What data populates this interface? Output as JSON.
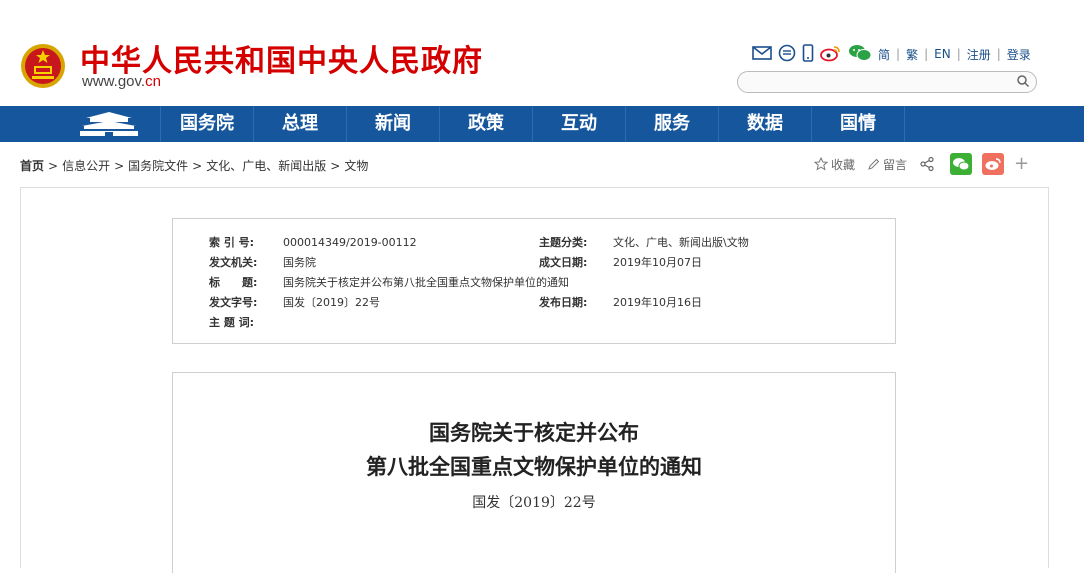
{
  "header": {
    "site_title": "中华人民共和国中央人民政府",
    "url_main": "www.gov.",
    "url_cn": "cn",
    "links": [
      "简",
      "繁",
      "EN",
      "注册",
      "登录"
    ],
    "icons": [
      "mail-icon",
      "message-icon",
      "mobile-icon",
      "weibo-icon",
      "wechat-icon"
    ]
  },
  "search": {
    "placeholder": ""
  },
  "nav": {
    "items": [
      "国务院",
      "总理",
      "新闻",
      "政策",
      "互动",
      "服务",
      "数据",
      "国情"
    ],
    "bg_color": "#15569d"
  },
  "breadcrumb": {
    "home": "首页",
    "items": [
      "信息公开",
      "国务院文件",
      "文化、广电、新闻出版",
      "文物"
    ]
  },
  "tools": {
    "favorite": "收藏",
    "comment": "留言"
  },
  "meta": {
    "index_label": "索 引 号:",
    "index_value": "000014349/2019-00112",
    "topic_label": "主题分类:",
    "topic_value": "文化、广电、新闻出版\\文物",
    "issuer_label": "发文机关:",
    "issuer_value": "国务院",
    "created_label": "成文日期:",
    "created_value": "2019年10月07日",
    "title_label": "标　　题:",
    "title_value": "国务院关于核定并公布第八批全国重点文物保护单位的通知",
    "docno_label": "发文字号:",
    "docno_value": "国发〔2019〕22号",
    "published_label": "发布日期:",
    "published_value": "2019年10月16日",
    "keywords_label": "主 题 词:",
    "keywords_value": ""
  },
  "document": {
    "title_line1": "国务院关于核定并公布",
    "title_line2": "第八批全国重点文物保护单位的通知",
    "number": "国发〔2019〕22号"
  }
}
